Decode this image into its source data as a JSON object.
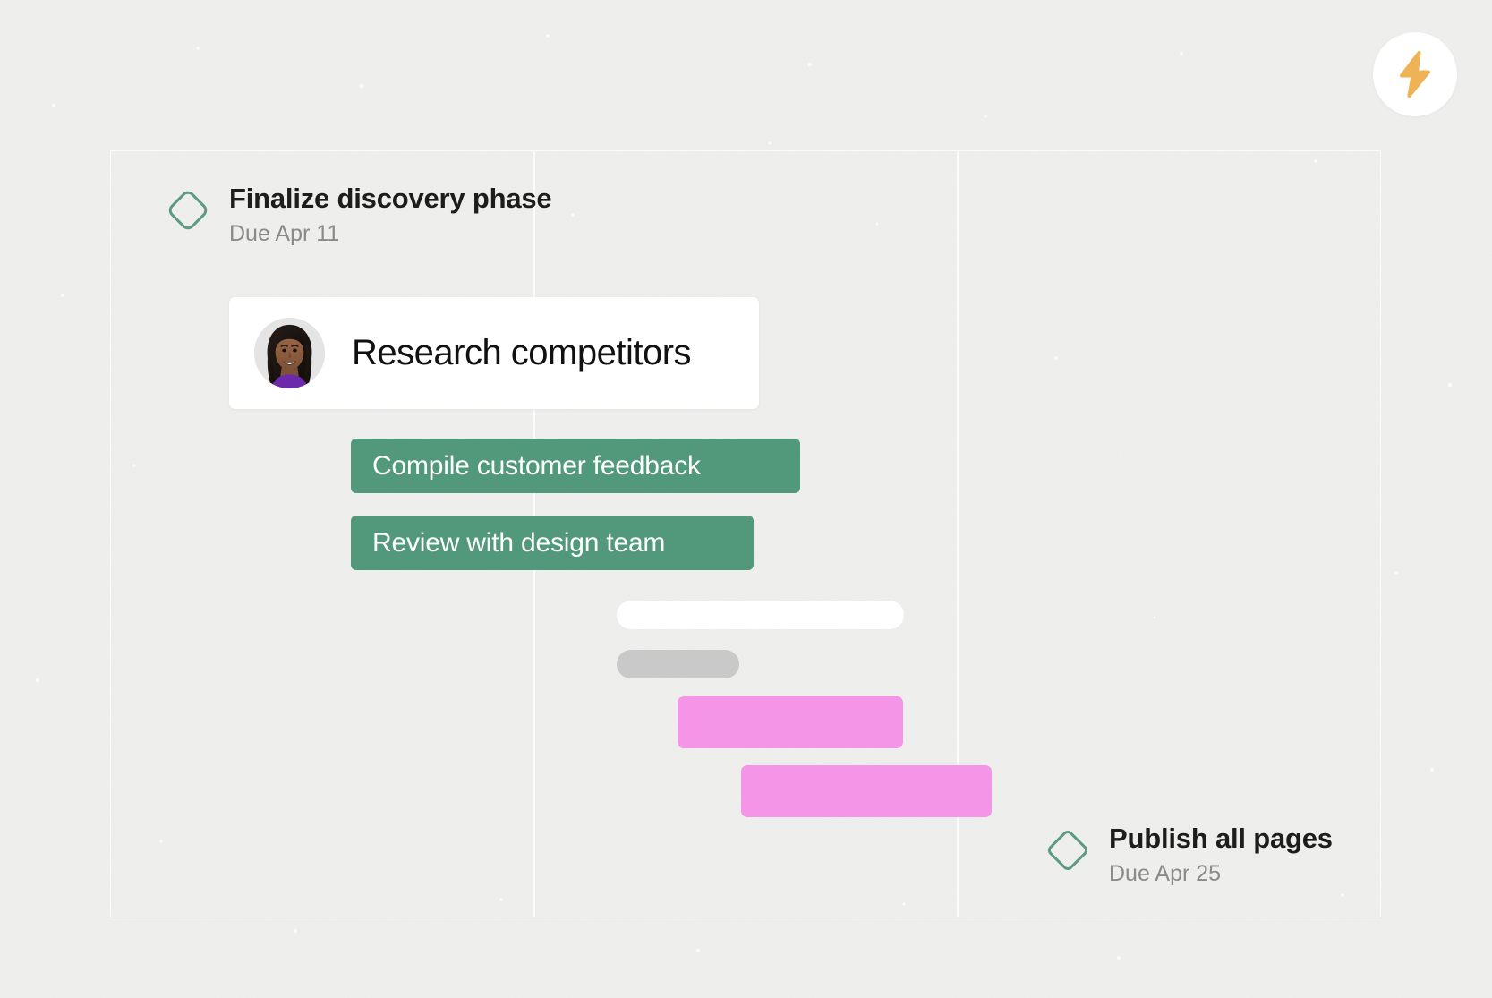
{
  "badge": {
    "icon": "lightning-bolt-icon",
    "bolt_color": "#edb355",
    "background": "#ffffff"
  },
  "theme": {
    "page_background": "#ececeb",
    "frame_line": "#fbfbfb",
    "milestone_green": "#5c9b80",
    "bar_green": "#51997a",
    "bar_pink": "#f595e8",
    "bar_white": "#ffffff",
    "bar_grey": "#c9c9c9",
    "title_color": "#1d1d1d",
    "due_color": "#8a8a8a"
  },
  "timeline": {
    "milestones": [
      {
        "id": "finalize-discovery-phase",
        "icon": "diamond-milestone-icon",
        "title": "Finalize discovery phase",
        "due": "Due Apr 11"
      },
      {
        "id": "publish-all-pages",
        "icon": "diamond-milestone-icon",
        "title": "Publish all pages",
        "due": "Due Apr 25"
      }
    ],
    "task_card": {
      "id": "research-competitors",
      "label": "Research competitors",
      "avatar": "user-avatar-photo"
    },
    "bars": [
      {
        "id": "compile-customer-feedback",
        "label": "Compile customer feedback",
        "color": "#51997a",
        "style": "green"
      },
      {
        "id": "review-with-design-team",
        "label": "Review with design team",
        "color": "#51997a",
        "style": "green"
      },
      {
        "id": "ghost-bar-white",
        "label": "",
        "color": "#ffffff",
        "style": "pill-white"
      },
      {
        "id": "ghost-bar-grey",
        "label": "",
        "color": "#c9c9c9",
        "style": "pill-grey"
      },
      {
        "id": "pink-bar-upper",
        "label": "",
        "color": "#f595e8",
        "style": "pink"
      },
      {
        "id": "pink-bar-lower",
        "label": "",
        "color": "#f595e8",
        "style": "pink"
      }
    ]
  }
}
